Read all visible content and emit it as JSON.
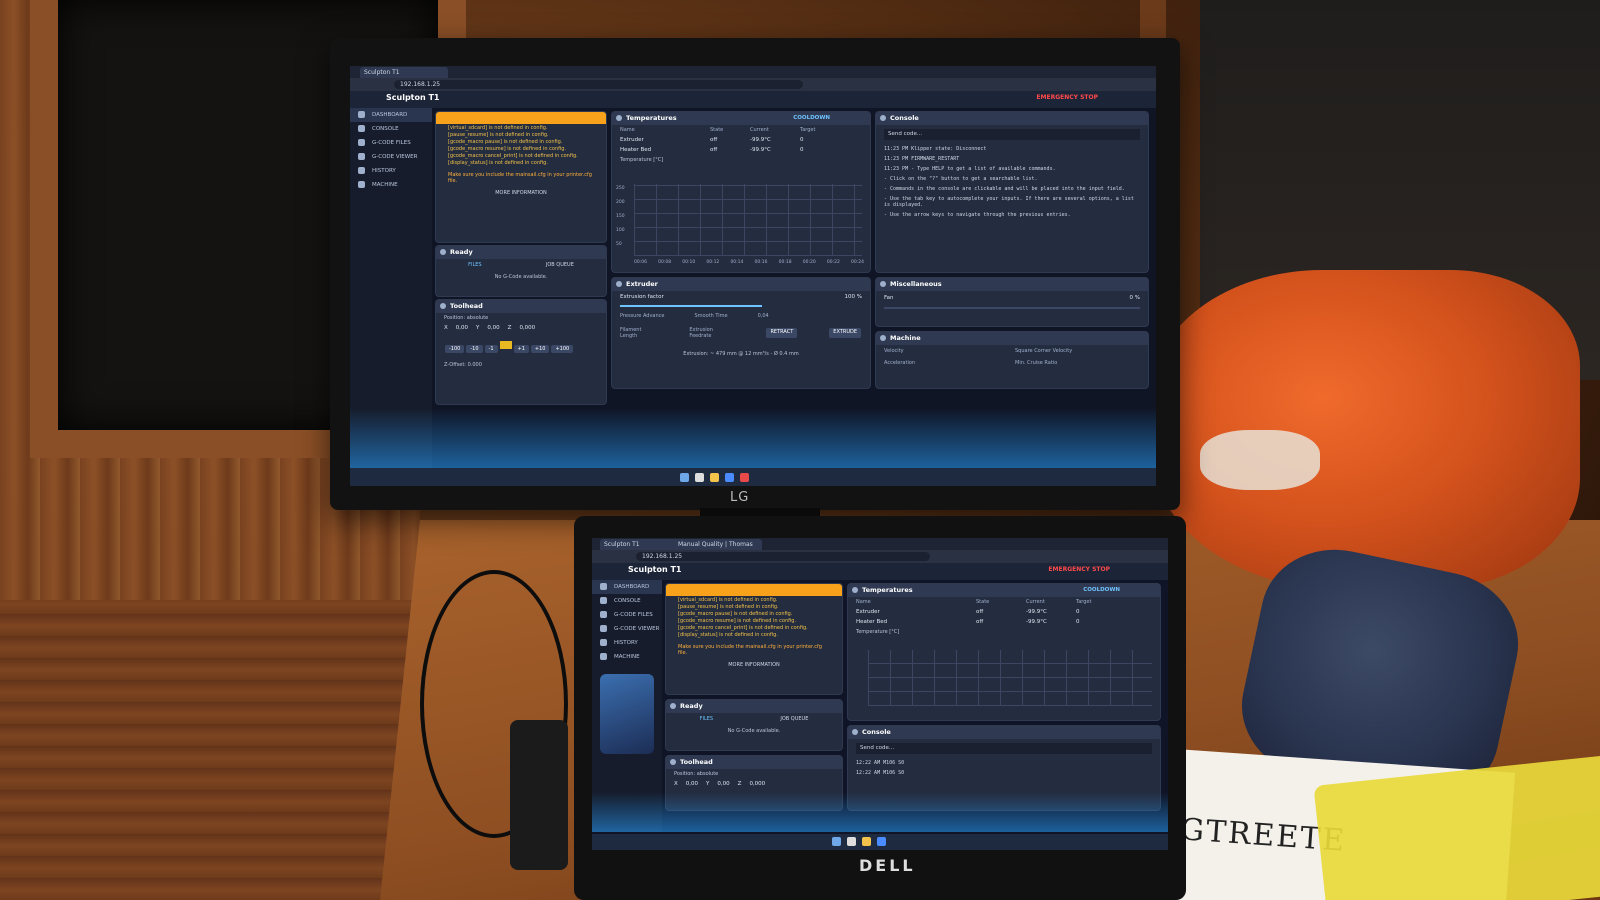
{
  "monitor_brand": "LG",
  "laptop_brand": "DELL",
  "paper_text": "GTREETE",
  "ui": {
    "tab_title": "Sculpton T1",
    "laptop_tab_2": "Manual Quality | Thomas",
    "url": "192.168.1.25",
    "app_title": "Sculpton T1",
    "emergency_stop": "EMERGENCY STOP",
    "sidebar": [
      "DASHBOARD",
      "CONSOLE",
      "G-CODE FILES",
      "G-CODE VIEWER",
      "HISTORY",
      "MACHINE"
    ],
    "warnings": [
      "[virtual_sdcard] is not defined in config.",
      "[pause_resume] is not defined in config.",
      "[gcode_macro pause] is not defined in config.",
      "[gcode_macro resume] is not defined in config.",
      "[gcode_macro cancel_print] is not defined in config.",
      "[display_status] is not defined in config."
    ],
    "warning_note": "Make sure you include the mainsail.cfg in your printer.cfg file.",
    "more_information": "MORE INFORMATION",
    "ready_title": "Ready",
    "files_tab": "FILES",
    "job_queue_tab": "JOB QUEUE",
    "no_gcode": "No G-Code available.",
    "toolhead_title": "Toolhead",
    "position": "Position: absolute",
    "axes": [
      {
        "label": "X",
        "value": "0,00"
      },
      {
        "label": "Y",
        "value": "0,00"
      },
      {
        "label": "Z",
        "value": "0,000"
      }
    ],
    "z_offset": "Z-Offset: 0.000",
    "temperatures_title": "Temperatures",
    "cooldown": "COOLDOWN",
    "temp_headers": [
      "Name",
      "State",
      "Current",
      "Target"
    ],
    "temp_rows": [
      {
        "name": "Extruder",
        "state": "off",
        "current": "-99.9°C",
        "target": "0"
      },
      {
        "name": "Heater Bed",
        "state": "off",
        "current": "-99.9°C",
        "target": "0"
      }
    ],
    "temp_chart_label": "Temperature [°C]",
    "temp_y_ticks": [
      "250",
      "200",
      "150",
      "100",
      "50"
    ],
    "temp_x_ticks": [
      "00:06",
      "00:08",
      "00:10",
      "00:12",
      "00:14",
      "00:16",
      "00:18",
      "00:20",
      "00:22",
      "00:24"
    ],
    "console_title": "Console",
    "send_code": "Send code...",
    "console_lines": [
      "11:23 PM  Klipper state: Disconnect",
      "11:23 PM  FIRMWARE_RESTART",
      "11:23 PM  - Type HELP to get a list of available commands.",
      "- Click on the \"?\" button to get a searchable list.",
      "- Commands in the console are clickable and will be placed into the input field.",
      "- Use the tab key to autocomplete your inputs. If there are several options, a list is displayed.",
      "- Use the arrow keys to navigate through the previous entries."
    ],
    "extruder_title": "Extruder",
    "extrusion_factor": "Extrusion factor",
    "extrusion_value": "100 %",
    "pressure_advance": "Pressure Advance",
    "smooth_time": "Smooth Time",
    "smooth_value": "0,04",
    "filament_length": "Filament Length",
    "extrusion_feedrate": "Extrusion Feedrate",
    "retract": "RETRACT",
    "extrude": "EXTRUDE",
    "extrusion_info": "Extrusion: ~ 479 mm @ 12 mm³/s - Ø 0.4 mm",
    "misc_title": "Miscellaneous",
    "fan_label": "Fan",
    "fan_value": "0 %",
    "machine_title": "Machine",
    "velocity": "Velocity",
    "square_corner": "Square Corner Velocity",
    "acceleration": "Acceleration",
    "accel_to_decel": "Min. Cruise Ratio",
    "move_buttons": [
      "-100",
      "-10",
      "-1",
      "+1",
      "+10",
      "+100"
    ],
    "laptop_console_lines": [
      "12:22 AM  M106 S0",
      "12:22 AM  M106 S0"
    ]
  }
}
